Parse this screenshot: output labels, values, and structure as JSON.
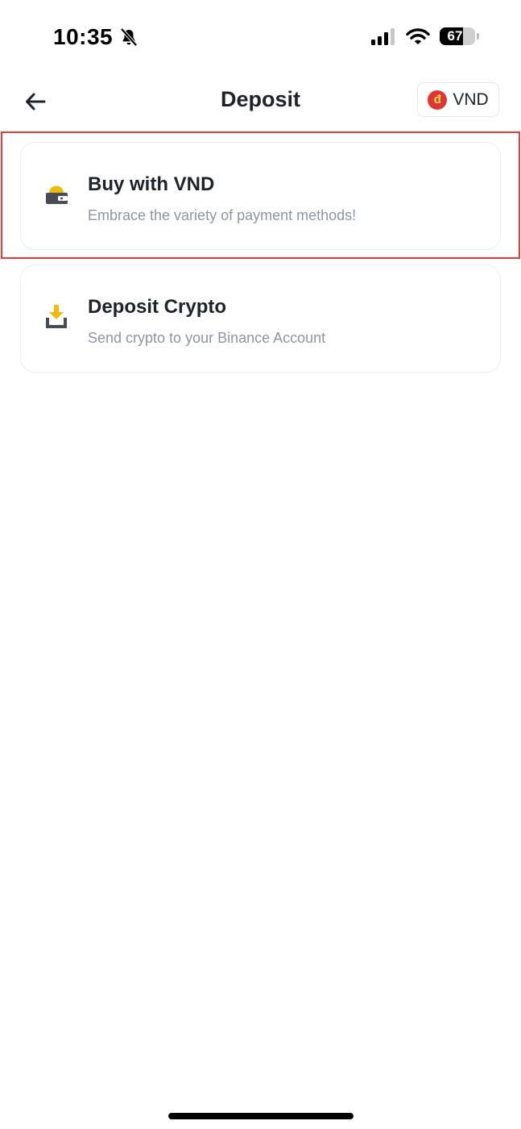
{
  "status_bar": {
    "time": "10:35",
    "battery_level": "67",
    "battery_fraction": 0.67,
    "icons": [
      "bell-slash-icon",
      "signal-icon",
      "wifi-icon",
      "battery-icon"
    ]
  },
  "header": {
    "title": "Deposit",
    "back_icon": "arrow-left-icon",
    "currency": {
      "flag_symbol": "đ",
      "label": "VND"
    }
  },
  "options": [
    {
      "title": "Buy with VND",
      "subtitle": "Embrace the variety of payment methods!",
      "icon": "wallet-icon",
      "highlighted": true
    },
    {
      "title": "Deposit Crypto",
      "subtitle": "Send crypto to your Binance Account",
      "icon": "download-tray-icon",
      "highlighted": false
    }
  ],
  "colors": {
    "accent": "#F0B90B",
    "icon_dark": "#474D57",
    "highlight_border": "#E43A3A",
    "text_primary": "#1E2329",
    "text_secondary": "#8E959E",
    "card_border": "#EAECEF"
  }
}
